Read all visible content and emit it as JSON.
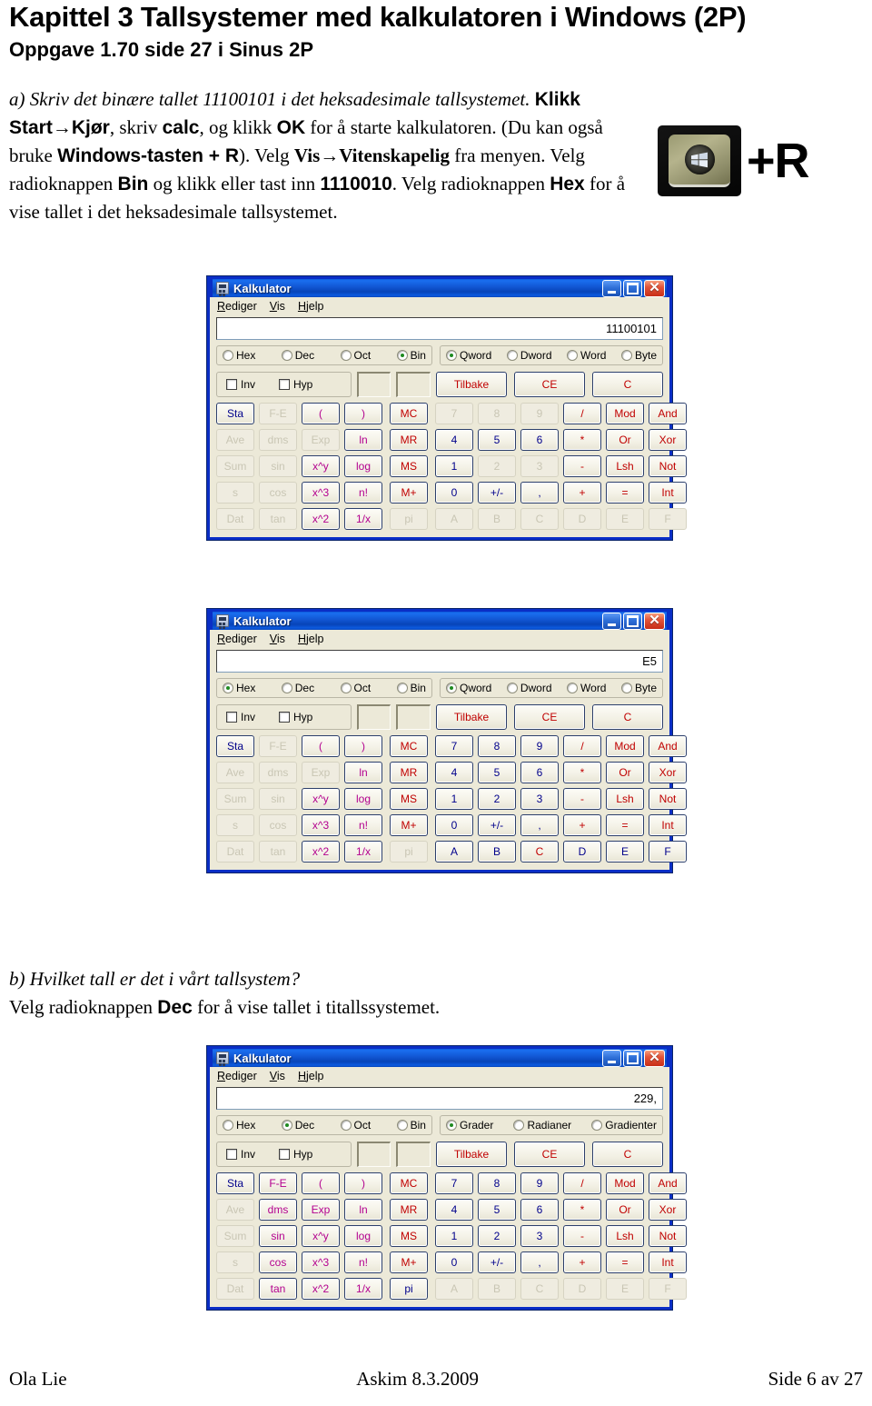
{
  "document": {
    "title": "Kapittel 3 Tallsystemer med kalkulatoren i Windows (2P)",
    "subtitle": "Oppgave 1.70 side 27 i Sinus 2P"
  },
  "task_a": {
    "question": "a) Skriv det binære tallet 11100101 i det heksadesimale tallsystemet.",
    "s1": "Klikk Start",
    "arrow1": "→",
    "s2": "Kjør",
    "s3": ", skriv ",
    "s4": "calc",
    "s5": ", og klikk ",
    "s6": "OK",
    "s7": " for å starte kalkulatoren. (Du kan også bruke ",
    "s8": "Windows-tasten + R",
    "s9": "). Velg ",
    "s10": "Vis",
    "arrow2": "→",
    "s11": "Vitenskapelig",
    "s12": " fra menyen. Velg radioknappen ",
    "s13": "Bin",
    "s14": " og klikk eller tast inn ",
    "s15": "1110010",
    "s16": ". Velg radioknappen ",
    "s17": "Hex",
    "s18": " for å vise tallet i det heksadesimale tallsystemet."
  },
  "winkey": {
    "plus_r": "+R",
    "icon": "windows-key-photo"
  },
  "task_b": {
    "question": "b) Hvilket tall er det i vårt tallsystem?",
    "s1": "Velg radioknappen ",
    "s2": "Dec",
    "s3": " for å vise tallet i titallssystemet."
  },
  "footer": {
    "author": "Ola Lie",
    "place_date": "Askim 8.3.2009",
    "page": "Side 6 av 27"
  },
  "calculator_common": {
    "title": "Kalkulator",
    "window_buttons": {
      "minimize": "minimize-icon",
      "maximize": "maximize-icon",
      "close": "✕"
    },
    "menu": [
      {
        "label": "Rediger",
        "mnemonic": "R",
        "rest": "ediger"
      },
      {
        "label": "Vis",
        "mnemonic": "V",
        "rest": "is"
      },
      {
        "label": "Hjelp",
        "mnemonic": "H",
        "rest": "jelp"
      }
    ],
    "base_options": [
      "Hex",
      "Dec",
      "Oct",
      "Bin"
    ],
    "word_options": [
      "Qword",
      "Dword",
      "Word",
      "Byte"
    ],
    "angle_options": [
      "Grader",
      "Radianer",
      "Gradienter"
    ],
    "checkboxes": [
      "Inv",
      "Hyp"
    ],
    "top_buttons": [
      "Tilbake",
      "CE",
      "C"
    ],
    "fn_keys": [
      "Sta",
      "F-E",
      "(",
      ")",
      "Ave",
      "dms",
      "Exp",
      "ln",
      "Sum",
      "sin",
      "x^y",
      "log",
      "s",
      "cos",
      "x^3",
      "n!",
      "Dat",
      "tan",
      "x^2",
      "1/x"
    ],
    "mem_keys": [
      "MC",
      "MR",
      "MS",
      "M+",
      "pi"
    ],
    "num_keys": [
      "7",
      "8",
      "9",
      "/",
      "Mod",
      "And",
      "4",
      "5",
      "6",
      "*",
      "Or",
      "Xor",
      "1",
      "2",
      "3",
      "-",
      "Lsh",
      "Not",
      "0",
      "+/-",
      ",",
      "+",
      "=",
      "Int",
      "A",
      "B",
      "C",
      "D",
      "E",
      "F"
    ]
  },
  "calculators": [
    {
      "name": "binary-mode",
      "display": "11100101",
      "selected_base": "Bin",
      "right_group": "word",
      "selected_right": "Qword",
      "disabled_fn": [
        "F-E",
        "Ave",
        "dms",
        "Exp",
        "Sum",
        "sin",
        "s",
        "cos",
        "Dat",
        "tan"
      ],
      "disabled_mem": [
        "pi"
      ],
      "disabled_num": [
        "7",
        "8",
        "9",
        "2",
        "3",
        "A",
        "B",
        "C",
        "D",
        "E",
        "F"
      ]
    },
    {
      "name": "hex-mode",
      "display": "E5",
      "selected_base": "Hex",
      "right_group": "word",
      "selected_right": "Qword",
      "disabled_fn": [
        "F-E",
        "Ave",
        "dms",
        "Exp",
        "Sum",
        "sin",
        "s",
        "cos",
        "Dat",
        "tan"
      ],
      "disabled_mem": [
        "pi"
      ],
      "disabled_num": []
    },
    {
      "name": "decimal-mode",
      "display": "229,",
      "selected_base": "Dec",
      "right_group": "angle",
      "selected_right": "Grader",
      "disabled_fn": [
        "Ave",
        "Sum",
        "s",
        "Dat"
      ],
      "disabled_mem": [],
      "disabled_num": [
        "A",
        "B",
        "C",
        "D",
        "E",
        "F"
      ]
    }
  ]
}
